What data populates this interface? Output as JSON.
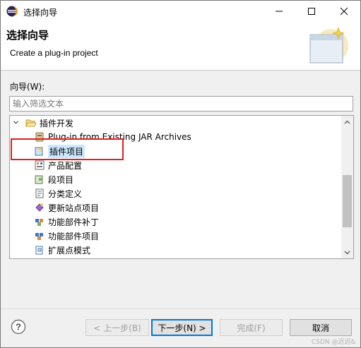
{
  "window": {
    "title": "选择向导"
  },
  "banner": {
    "title": "选择向导",
    "description": "Create a plug-in project"
  },
  "wizards": {
    "label": "向导(W):",
    "filter_placeholder": "输入筛选文本",
    "category": {
      "label": "插件开发",
      "expanded": true
    },
    "items": [
      {
        "label": "Plug-in from Existing JAR Archives",
        "icon": "jar-plugin-icon"
      },
      {
        "label": "插件项目",
        "icon": "plugin-project-icon",
        "selected": true
      },
      {
        "label": "产品配置",
        "icon": "product-config-icon"
      },
      {
        "label": "段项目",
        "icon": "fragment-project-icon"
      },
      {
        "label": "分类定义",
        "icon": "category-definition-icon"
      },
      {
        "label": "更新站点项目",
        "icon": "update-site-icon"
      },
      {
        "label": "功能部件补丁",
        "icon": "feature-patch-icon"
      },
      {
        "label": "功能部件项目",
        "icon": "feature-project-icon"
      },
      {
        "label": "扩展点模式",
        "icon": "extension-point-schema-icon"
      }
    ]
  },
  "buttons": {
    "back": "< 上一步(B)",
    "next": "下一步(N) >",
    "finish": "完成(F)",
    "cancel": "取消"
  },
  "watermark": "CSDN @迟迟&",
  "colors": {
    "selection": "#cce8ff",
    "highlight_box": "#e02020",
    "primary_border": "#0078d7"
  }
}
